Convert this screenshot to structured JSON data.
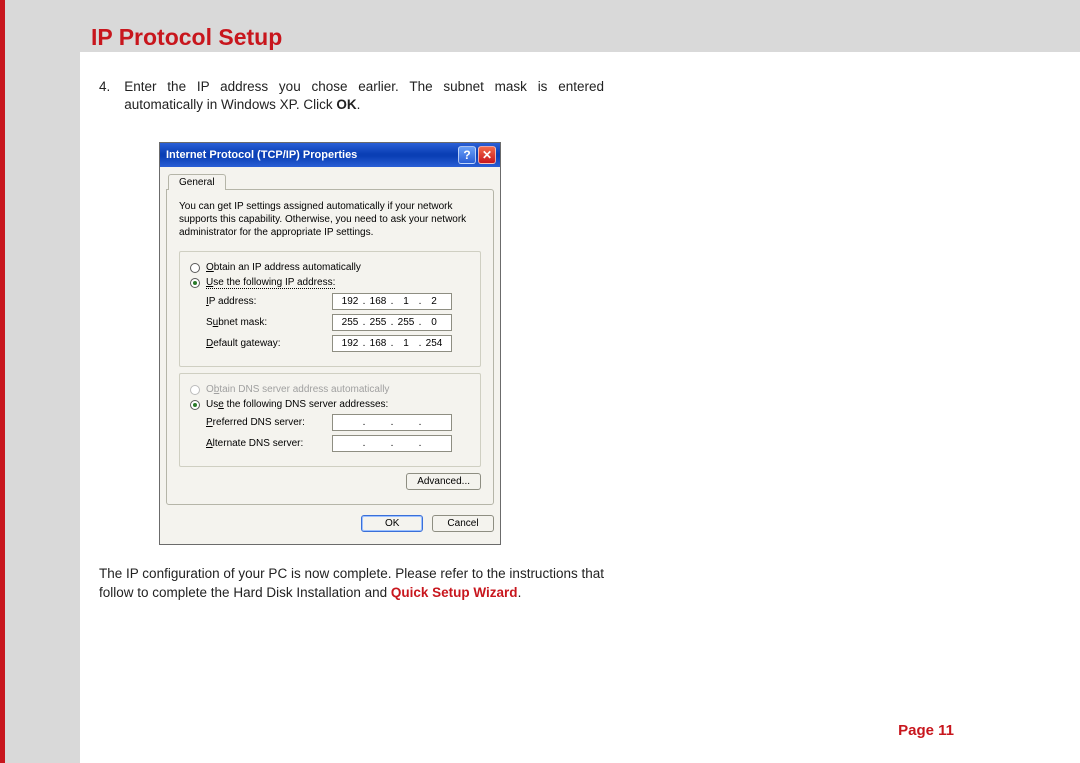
{
  "page": {
    "title": "IP Protocol Setup",
    "step_number": "4.",
    "step_text_1": "Enter the IP address you chose earlier. The subnet mask is entered automatically in Windows XP. Click ",
    "step_ok": "OK",
    "step_period": ".",
    "outro_1": "The IP configuration of your PC is now complete. Please refer to the instructions that follow to complete the Hard Disk Installation and ",
    "outro_link": "Quick Setup Wizard",
    "outro_period": ".",
    "page_label": "Page 11"
  },
  "dialog": {
    "title": "Internet Protocol (TCP/IP) Properties",
    "help": "?",
    "close": "✕",
    "tab": "General",
    "intro": "You can get IP settings assigned automatically if your network supports this capability. Otherwise, you need to ask your network administrator for the appropriate IP settings.",
    "radio_obtain_ip_pre": "O",
    "radio_obtain_ip": "btain an IP address automatically",
    "radio_use_ip_pre": "U",
    "radio_use_ip": "se the following IP address:",
    "ip_label_pre": "I",
    "ip_label": "P address:",
    "subnet_label": "Subnet mask:",
    "subnet_label_pre": "S",
    "subnet_label_u": "u",
    "subnet_label_post": "bnet mask:",
    "gateway_label_pre": "D",
    "gateway_label": "efault gateway:",
    "ip_value": {
      "a": "192",
      "b": "168",
      "c": "1",
      "d": "2"
    },
    "subnet_value": {
      "a": "255",
      "b": "255",
      "c": "255",
      "d": "0"
    },
    "gateway_value": {
      "a": "192",
      "b": "168",
      "c": "1",
      "d": "254"
    },
    "radio_obtain_dns_pre": "O",
    "radio_obtain_dns_u": "b",
    "radio_obtain_dns": "tain DNS server address automatically",
    "radio_use_dns": "Use the following DNS server addresses:",
    "radio_use_dns_pre": "Us",
    "radio_use_dns_u": "e",
    "radio_use_dns_post": " the following DNS server addresses:",
    "pref_dns_label_pre": "P",
    "pref_dns_label": "referred DNS server:",
    "alt_dns_label_pre": "A",
    "alt_dns_label": "lternate DNS server:",
    "advanced": "Advanced...",
    "ok": "OK",
    "cancel": "Cancel"
  }
}
